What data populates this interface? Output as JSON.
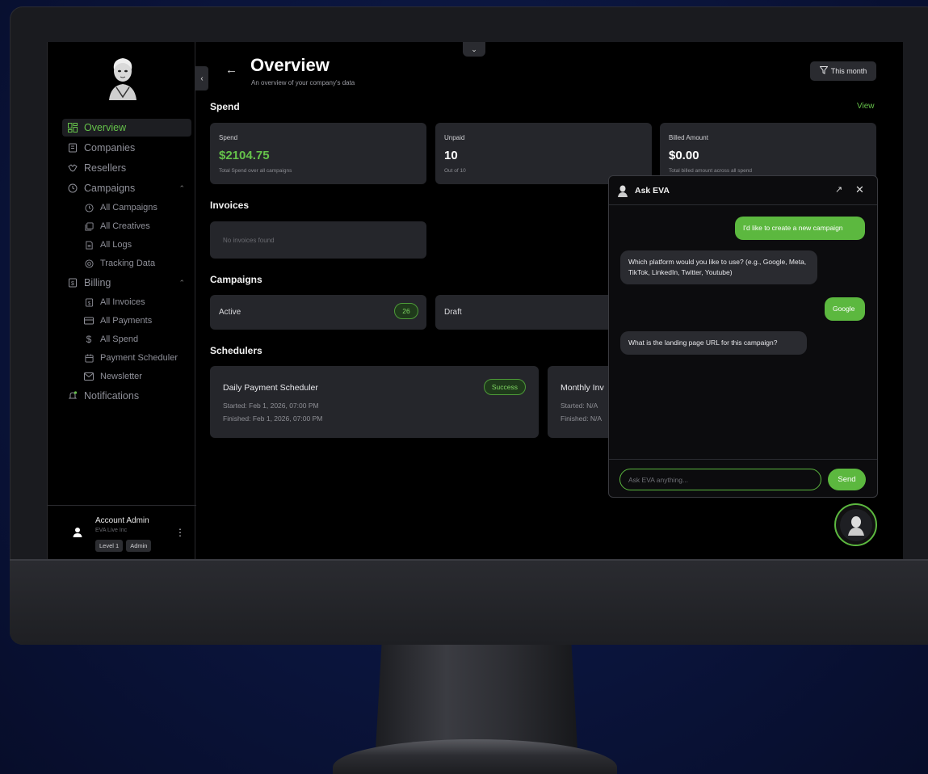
{
  "header": {
    "title": "Overview",
    "subtitle": "An overview of your company's data",
    "filter_label": "This month"
  },
  "sidebar": {
    "items": [
      {
        "label": "Overview",
        "icon": "grid-icon",
        "active": true
      },
      {
        "label": "Companies",
        "icon": "building-icon"
      },
      {
        "label": "Resellers",
        "icon": "handshake-icon"
      },
      {
        "label": "Campaigns",
        "icon": "clock-icon",
        "expanded": true
      },
      {
        "label": "All Campaigns",
        "icon": "clock-icon"
      },
      {
        "label": "All Creatives",
        "icon": "images-icon"
      },
      {
        "label": "All Logs",
        "icon": "document-icon"
      },
      {
        "label": "Tracking Data",
        "icon": "target-icon"
      },
      {
        "label": "Billing",
        "icon": "receipt-icon",
        "expanded": true
      },
      {
        "label": "All Invoices",
        "icon": "invoice-icon"
      },
      {
        "label": "All Payments",
        "icon": "credit-card-icon"
      },
      {
        "label": "All Spend",
        "icon": "dollar-icon"
      },
      {
        "label": "Payment Scheduler",
        "icon": "calendar-icon"
      },
      {
        "label": "Newsletter",
        "icon": "mail-icon"
      },
      {
        "label": "Notifications",
        "icon": "bell-icon"
      }
    ]
  },
  "account": {
    "name": "Account Admin",
    "org": "EVA Live Inc",
    "badges": [
      "Level 1",
      "Admin"
    ]
  },
  "spend": {
    "section_title": "Spend",
    "view_label": "View",
    "cards": [
      {
        "label": "Spend",
        "value": "$2104.75",
        "note": "Total Spend over all campaigns"
      },
      {
        "label": "Unpaid",
        "value": "10",
        "note": "Out of 10"
      },
      {
        "label": "Billed Amount",
        "value": "$0.00",
        "note": "Total billed amount across all spend"
      }
    ]
  },
  "invoices": {
    "section_title": "Invoices",
    "empty_text": "No invoices found"
  },
  "campaigns": {
    "section_title": "Campaigns",
    "active_label": "Active",
    "active_count": "26",
    "draft_label": "Draft"
  },
  "schedulers": {
    "section_title": "Schedulers",
    "items": [
      {
        "name": "Daily Payment Scheduler",
        "status": "Success",
        "started": "Started: Feb 1, 2026, 07:00 PM",
        "finished": "Finished: Feb 1, 2026, 07:00 PM"
      },
      {
        "name": "Monthly Inv",
        "started": "Started: N/A",
        "finished": "Finished: N/A"
      }
    ]
  },
  "chat": {
    "title": "Ask EVA",
    "messages": [
      {
        "role": "user",
        "text": "I'd like to create a new campaign"
      },
      {
        "role": "bot",
        "text": "Which platform would you like to use? (e.g., Google, Meta, TikTok, LinkedIn, Twitter, Youtube)"
      },
      {
        "role": "user",
        "text": "Google"
      },
      {
        "role": "bot",
        "text": "What is the landing page URL for this campaign?"
      }
    ],
    "input_placeholder": "Ask EVA anything...",
    "send_label": "Send"
  },
  "colors": {
    "accent": "#65c24a",
    "background": "#000000",
    "card": "#25262b"
  }
}
